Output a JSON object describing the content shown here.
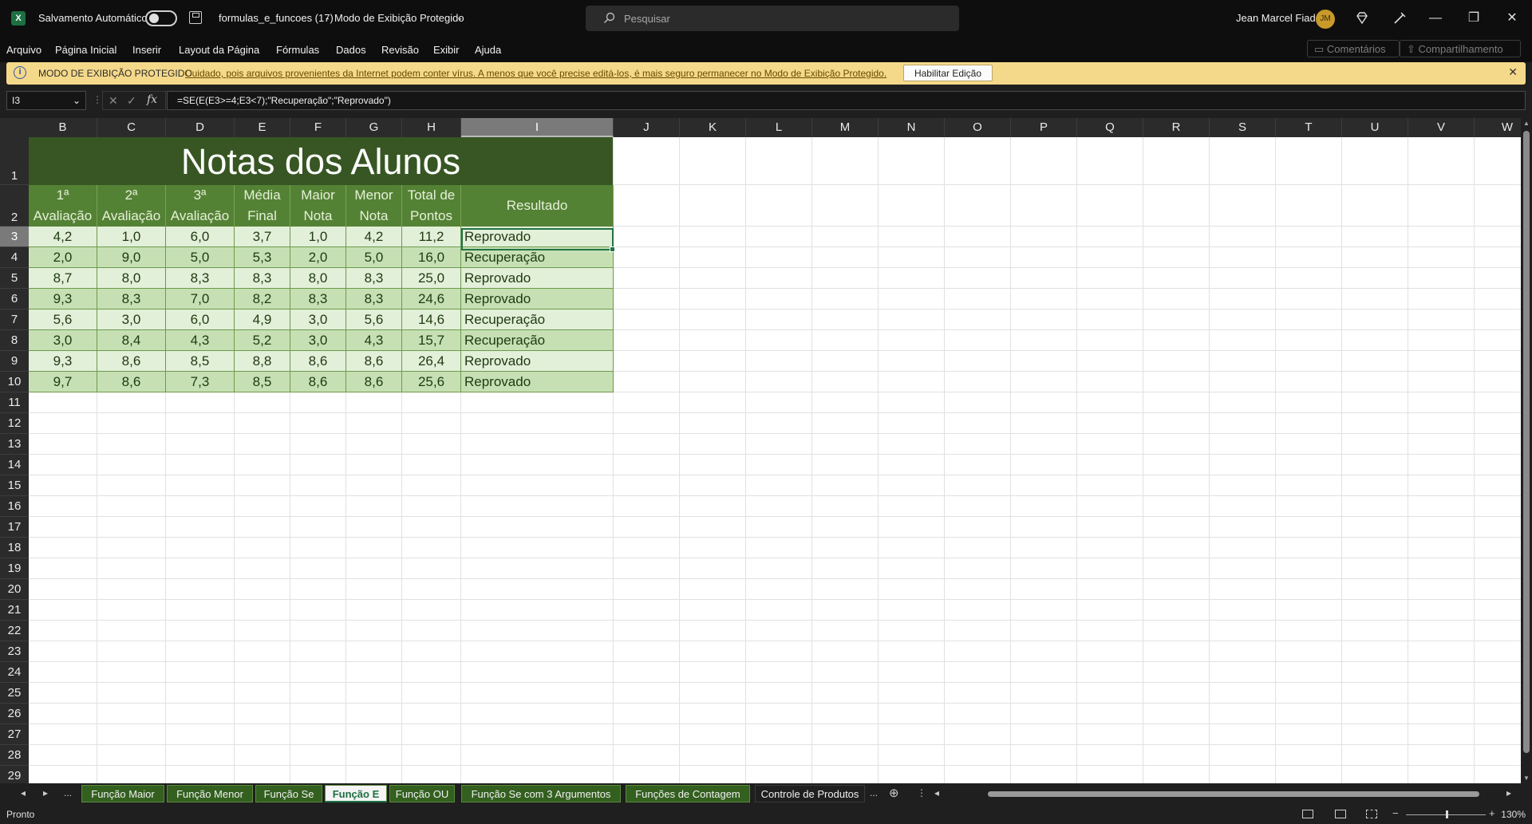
{
  "titlebar": {
    "autosave_label": "Salvamento Automático",
    "filename": "formulas_e_funcoes (17)",
    "separator": "-",
    "mode": "Modo de Exibição Protegido",
    "search_placeholder": "Pesquisar",
    "user_name": "Jean Marcel Fiad",
    "user_initials": "JM",
    "app_icon": "X"
  },
  "menu": {
    "items": [
      "Arquivo",
      "Página Inicial",
      "Inserir",
      "Layout da Página",
      "Fórmulas",
      "Dados",
      "Revisão",
      "Exibir",
      "Ajuda"
    ],
    "comments": "Comentários",
    "share": "Compartilhamento"
  },
  "protected_bar": {
    "label": "MODO DE EXIBIÇÃO PROTEGIDO",
    "message": "Cuidado, pois arquivos provenientes da Internet podem conter vírus. A menos que você precise editá-los, é mais seguro permanecer no Modo de  Exibição Protegido.",
    "enable_button": "Habilitar Edição"
  },
  "formula_bar": {
    "cell_ref": "I3",
    "formula": "=SE(E(E3>=4;E3<7);\"Recuperação\";\"Reprovado\")",
    "fx": "fx"
  },
  "columns": [
    "B",
    "C",
    "D",
    "E",
    "F",
    "G",
    "H",
    "I",
    "J",
    "K",
    "L",
    "M",
    "N",
    "O",
    "P",
    "Q",
    "R",
    "S",
    "T",
    "U",
    "V",
    "W"
  ],
  "selected_column": "I",
  "selected_row": "3",
  "row_numbers": [
    "1",
    "2",
    "3",
    "4",
    "5",
    "6",
    "7",
    "8",
    "9",
    "10",
    "11",
    "12",
    "13",
    "14",
    "15",
    "16",
    "17",
    "18",
    "19",
    "20",
    "21",
    "22",
    "23",
    "24",
    "25",
    "26",
    "27",
    "28",
    "29"
  ],
  "table": {
    "title": "Notas dos Alunos",
    "headers": [
      "1ª\nAvaliação",
      "2ª\nAvaliação",
      "3ª\nAvaliação",
      "Média\nFinal",
      "Maior\nNota",
      "Menor\nNota",
      "Total de\nPontos",
      "Resultado"
    ],
    "rows": [
      [
        "4,2",
        "1,0",
        "6,0",
        "3,7",
        "1,0",
        "4,2",
        "11,2",
        "Reprovado"
      ],
      [
        "2,0",
        "9,0",
        "5,0",
        "5,3",
        "2,0",
        "5,0",
        "16,0",
        "Recuperação"
      ],
      [
        "8,7",
        "8,0",
        "8,3",
        "8,3",
        "8,0",
        "8,3",
        "25,0",
        "Reprovado"
      ],
      [
        "9,3",
        "8,3",
        "7,0",
        "8,2",
        "8,3",
        "8,3",
        "24,6",
        "Reprovado"
      ],
      [
        "5,6",
        "3,0",
        "6,0",
        "4,9",
        "3,0",
        "5,6",
        "14,6",
        "Recuperação"
      ],
      [
        "3,0",
        "8,4",
        "4,3",
        "5,2",
        "3,0",
        "4,3",
        "15,7",
        "Recuperação"
      ],
      [
        "9,3",
        "8,6",
        "8,5",
        "8,8",
        "8,6",
        "8,6",
        "26,4",
        "Reprovado"
      ],
      [
        "9,7",
        "8,6",
        "7,3",
        "8,5",
        "8,6",
        "8,6",
        "25,6",
        "Reprovado"
      ]
    ]
  },
  "sheet_tabs": {
    "ellipsis": "...",
    "tabs": [
      "Função Maior",
      "Função Menor",
      "Função Se",
      "Função E",
      "Função OU",
      "Função Se com 3 Argumentos",
      "Funções de Contagem",
      "Controle de Produtos"
    ],
    "active": "Função E",
    "more": "..."
  },
  "status": {
    "ready": "Pronto",
    "zoom": "130%"
  },
  "colors": {
    "title_bg": "#375623",
    "header_bg": "#548235",
    "row_light": "#e2efd9",
    "row_dark": "#c6e0b4",
    "protected_bar": "#f5d98a",
    "accent": "#217346"
  }
}
